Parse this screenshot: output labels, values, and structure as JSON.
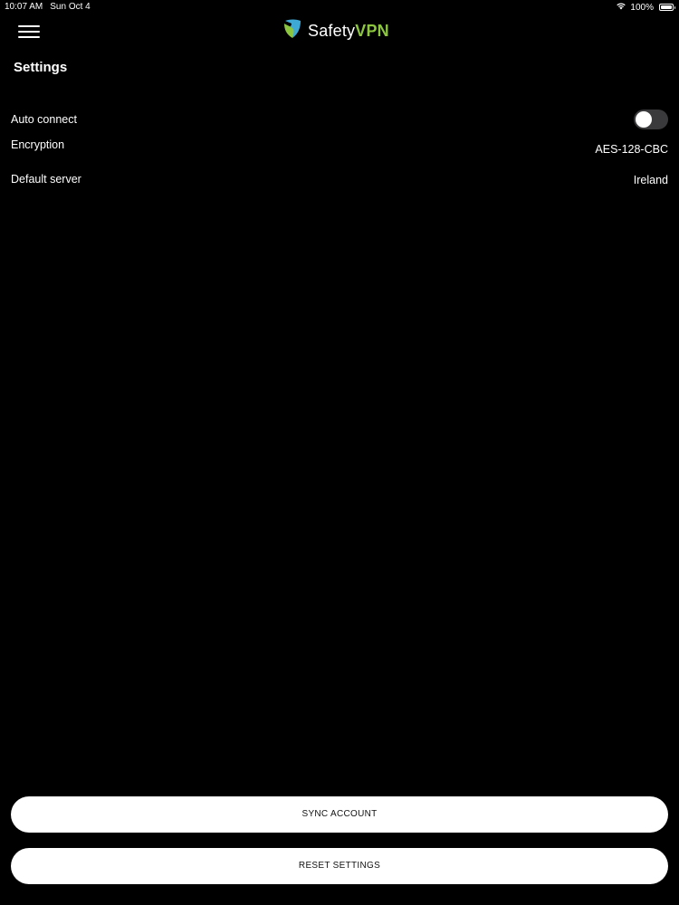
{
  "status_bar": {
    "time": "10:07 AM",
    "date": "Sun Oct 4",
    "battery_percent_label": "100%",
    "battery_level": 1.0,
    "wifi_icon": "wifi-icon",
    "battery_icon": "battery-icon"
  },
  "header": {
    "menu_icon": "hamburger-menu-icon",
    "logo_icon": "shield-logo-icon",
    "brand_part1": "Safety",
    "brand_part2": "VPN"
  },
  "page": {
    "title": "Settings"
  },
  "settings": {
    "auto_connect": {
      "label": "Auto connect",
      "enabled": false
    },
    "encryption": {
      "label": "Encryption",
      "value": "AES-128-CBC"
    },
    "default_server": {
      "label": "Default server",
      "value": "Ireland"
    }
  },
  "actions": {
    "sync_label": "SYNC ACCOUNT",
    "reset_label": "RESET SETTINGS"
  },
  "colors": {
    "background": "#000000",
    "text": "#ffffff",
    "brand_green": "#8cc63f",
    "brand_blue": "#3fa9d6",
    "toggle_off": "#3a3a3c",
    "button_bg": "#ffffff"
  }
}
